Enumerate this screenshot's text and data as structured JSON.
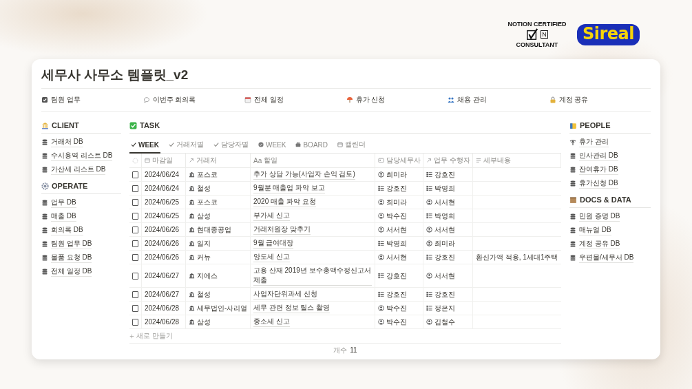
{
  "logos": {
    "badge_top": "NOTION CERTIFIED",
    "badge_bottom": "CONSULTANT",
    "badge_mark": "N",
    "brand": "Sireal"
  },
  "title": "세무사 사무소 템플릿_v2",
  "links": [
    {
      "label": "팀원 업무"
    },
    {
      "label": "이번주 회의록"
    },
    {
      "label": "전체 일정"
    },
    {
      "label": "휴가 신청"
    },
    {
      "label": "채용 관리"
    },
    {
      "label": "계정 공유"
    }
  ],
  "left_sections": [
    {
      "title": "CLIENT",
      "items": [
        {
          "label": "거래처 DB",
          "kind": "database"
        },
        {
          "label": "수시용역 리스트 DB",
          "kind": "database"
        },
        {
          "label": "가산세 리스트 DB",
          "kind": "database"
        }
      ]
    },
    {
      "title": "OPERATE",
      "items": [
        {
          "label": "업무 DB",
          "kind": "database"
        },
        {
          "label": "매출 DB",
          "kind": "database"
        },
        {
          "label": "회의록 DB",
          "kind": "database"
        },
        {
          "label": "팀원 업무 DB",
          "kind": "database"
        },
        {
          "label": "물품 요청 DB",
          "kind": "database"
        },
        {
          "label": "전체 일정 DB",
          "kind": "database"
        }
      ]
    }
  ],
  "task": {
    "title": "TASK",
    "views": [
      {
        "label": "WEEK",
        "selected": true
      },
      {
        "label": "거래처별",
        "selected": false
      },
      {
        "label": "담당자별",
        "selected": false
      },
      {
        "label": "WEEK",
        "selected": false
      },
      {
        "label": "BOARD",
        "selected": false
      },
      {
        "label": "캘린더",
        "selected": false
      }
    ],
    "columns": [
      {
        "label": "마감일"
      },
      {
        "label": "거래처"
      },
      {
        "label": "할일",
        "prefix": "Aa"
      },
      {
        "label": "담당세무사"
      },
      {
        "label": "업무 수행자"
      },
      {
        "label": "세부내용"
      }
    ],
    "rows": [
      {
        "checked": false,
        "date": "2024/06/24",
        "client": "포스코",
        "task": "추가 상담 가능(사업자 손익 검토)",
        "manager": {
          "name": "최미라",
          "kind": "person"
        },
        "worker": {
          "name": "강호진",
          "kind": "group"
        }
      },
      {
        "checked": false,
        "date": "2024/06/24",
        "client": "철성",
        "task": "9월분 매출업 파악 보고",
        "manager": {
          "name": "강호진",
          "kind": "group"
        },
        "worker": {
          "name": "박영희",
          "kind": "group"
        }
      },
      {
        "checked": false,
        "date": "2024/06/25",
        "client": "포스코",
        "task": "2020 매출 파악 요청",
        "manager": {
          "name": "최미라",
          "kind": "person"
        },
        "worker": {
          "name": "서서현",
          "kind": "person"
        }
      },
      {
        "checked": false,
        "date": "2024/06/25",
        "client": "삼성",
        "task": "부가세 신고",
        "manager": {
          "name": "박수진",
          "kind": "person"
        },
        "worker": {
          "name": "박영희",
          "kind": "group"
        }
      },
      {
        "checked": false,
        "date": "2024/06/26",
        "client": "현대중공업",
        "task": "거래처원장 맞추기",
        "manager": {
          "name": "서서현",
          "kind": "person"
        },
        "worker": {
          "name": "서서현",
          "kind": "person"
        }
      },
      {
        "checked": false,
        "date": "2024/06/26",
        "client": "일지",
        "task": "9월 급여대장",
        "manager": {
          "name": "박영희",
          "kind": "group"
        },
        "worker": {
          "name": "최미라",
          "kind": "person"
        }
      },
      {
        "checked": false,
        "date": "2024/06/26",
        "client": "커뉴",
        "task": "양도세 신고",
        "manager": {
          "name": "서서현",
          "kind": "person"
        },
        "worker": {
          "name": "강호진",
          "kind": "group"
        },
        "detail": "환신가액 적용, 1세대1주택"
      },
      {
        "checked": false,
        "date": "2024/06/27",
        "client": "지에스",
        "task": "고용 산재 2019년 보수총액수정신고서 제출",
        "manager": {
          "name": "강호진",
          "kind": "group"
        },
        "worker": {
          "name": "서서현",
          "kind": "person"
        }
      },
      {
        "checked": false,
        "date": "2024/06/27",
        "client": "철성",
        "task": "사업자단위과세 신청",
        "manager": {
          "name": "강호진",
          "kind": "group"
        },
        "worker": {
          "name": "강호진",
          "kind": "group"
        }
      },
      {
        "checked": false,
        "date": "2024/06/28",
        "client": "세무법인-사리얼",
        "task": "세무 관련 정보 릴스 촬영",
        "manager": {
          "name": "박수진",
          "kind": "person"
        },
        "worker": {
          "name": "정은지",
          "kind": "group"
        }
      },
      {
        "checked": false,
        "date": "2024/06/28",
        "client": "삼성",
        "task": "종소세 신고",
        "manager": {
          "name": "박수진",
          "kind": "person"
        },
        "worker": {
          "name": "김철수",
          "kind": "person"
        }
      }
    ],
    "new_row": "새로 만들기",
    "count_label": "개수",
    "count": "11"
  },
  "right_sections": [
    {
      "title": "PEOPLE",
      "items": [
        {
          "label": "휴가 관리",
          "kind": "page"
        },
        {
          "label": "인사관리 DB",
          "kind": "database"
        },
        {
          "label": "잔여휴가 DB",
          "kind": "database"
        },
        {
          "label": "휴가신청 DB",
          "kind": "database"
        }
      ]
    },
    {
      "title": "DOCS & DATA",
      "items": [
        {
          "label": "민원 증명 DB",
          "kind": "database"
        },
        {
          "label": "매뉴얼 DB",
          "kind": "database"
        },
        {
          "label": "계정 공유 DB",
          "kind": "database"
        },
        {
          "label": "우편물/세무서 DB",
          "kind": "database"
        }
      ]
    }
  ]
}
